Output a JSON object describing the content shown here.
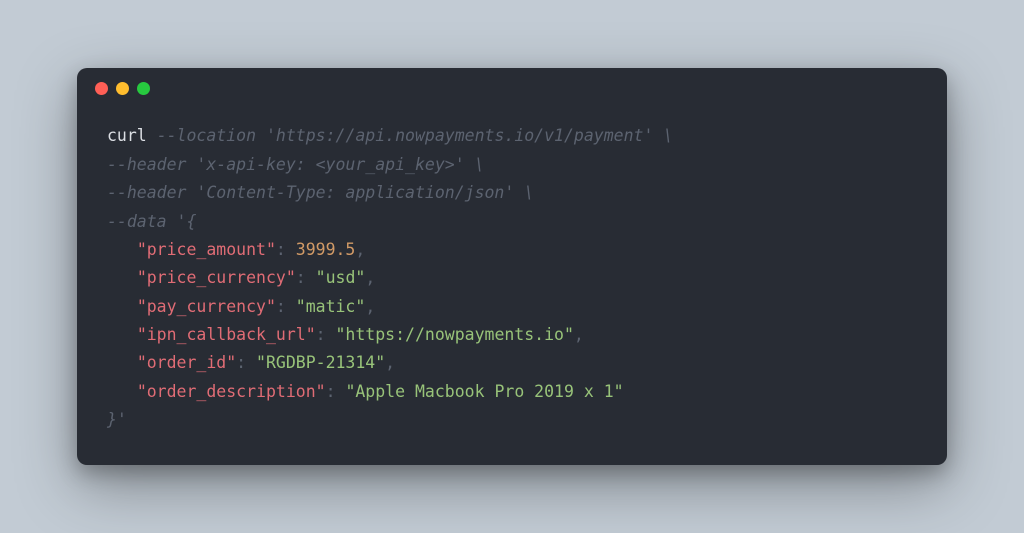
{
  "titlebar": {
    "buttons": [
      "close",
      "minimize",
      "zoom"
    ]
  },
  "colors": {
    "bg": "#c2cbd4",
    "window": "#282c34",
    "close": "#ff5f56",
    "minimize": "#ffbd2e",
    "zoom": "#27c93f"
  },
  "code": {
    "cmd": "curl",
    "loc_flag": "--location",
    "loc_val": "'https://api.nowpayments.io/v1/payment'",
    "cont1": " \\",
    "hdr_flag1": "--header",
    "hdr_val1": "'x-api-key: <your_api_key>'",
    "cont2": " \\",
    "hdr_flag2": "--header",
    "hdr_val2": "'Content-Type: application/json'",
    "cont3": " \\",
    "data_flag": "--data",
    "data_open": "'{",
    "indent": "   ",
    "k_price_amount": "\"price_amount\"",
    "colon": ": ",
    "v_price_amount": "3999.5",
    "comma": ",",
    "k_price_currency": "\"price_currency\"",
    "v_price_currency": "\"usd\"",
    "k_pay_currency": "\"pay_currency\"",
    "v_pay_currency": "\"matic\"",
    "k_ipn": "\"ipn_callback_url\"",
    "v_ipn": "\"https://nowpayments.io\"",
    "k_order_id": "\"order_id\"",
    "v_order_id": "\"RGDBP-21314\"",
    "k_order_desc": "\"order_description\"",
    "v_order_desc": "\"Apple Macbook Pro 2019 x 1\"",
    "data_close": "}'"
  }
}
